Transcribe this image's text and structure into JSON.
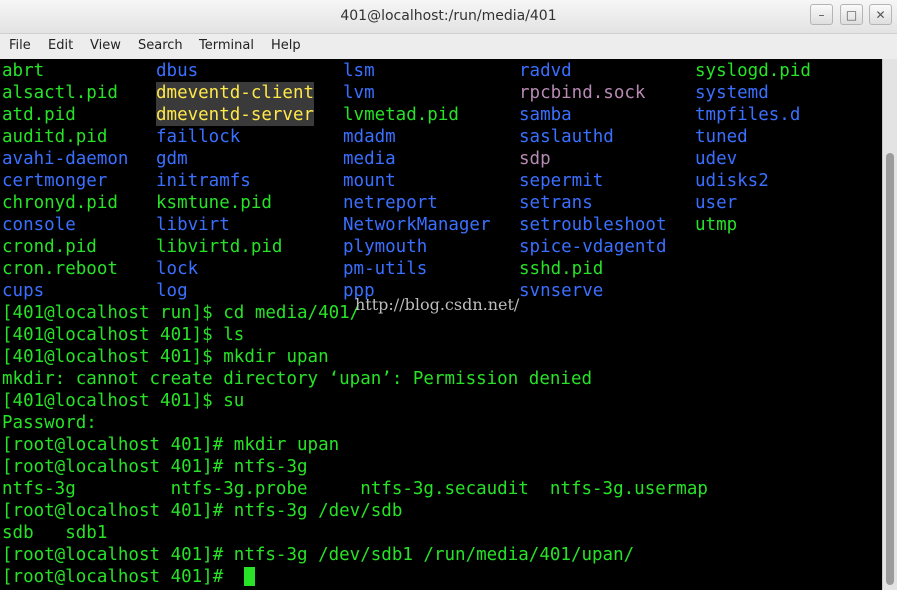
{
  "window": {
    "title": "401@localhost:/run/media/401",
    "minimize_glyph": "–",
    "maximize_glyph": "□",
    "close_glyph": "✕"
  },
  "menu": {
    "file": "File",
    "edit": "Edit",
    "view": "View",
    "search": "Search",
    "terminal": "Terminal",
    "help": "Help"
  },
  "listing": {
    "col1": [
      "abrt",
      "alsactl.pid",
      "atd.pid",
      "auditd.pid",
      "avahi-daemon",
      "certmonger",
      "chronyd.pid",
      "console",
      "crond.pid",
      "cron.reboot",
      "cups"
    ],
    "col2": [
      "dbus",
      "dmeventd-client",
      "dmeventd-server",
      "faillock",
      "gdm",
      "initramfs",
      "ksmtune.pid",
      "libvirt",
      "libvirtd.pid",
      "lock",
      "log"
    ],
    "col3": [
      "lsm",
      "lvm",
      "lvmetad.pid",
      "mdadm",
      "media",
      "mount",
      "netreport",
      "NetworkManager",
      "plymouth",
      "pm-utils",
      "ppp"
    ],
    "col4": [
      "radvd",
      "rpcbind.sock",
      "samba",
      "saslauthd",
      "sdp",
      "sepermit",
      "setrans",
      "setroubleshoot",
      "spice-vdagentd",
      "sshd.pid",
      "svnserve"
    ],
    "col5": [
      "syslogd.pid",
      "systemd",
      "tmpfiles.d",
      "tuned",
      "udev",
      "udisks2",
      "user",
      "utmp"
    ]
  },
  "colors": {
    "col1": [
      "green",
      "green",
      "green",
      "green",
      "blue",
      "blue",
      "green",
      "blue",
      "green",
      "green",
      "blue"
    ],
    "col2": [
      "blue",
      "yellow",
      "yellow",
      "blue",
      "blue",
      "blue",
      "green",
      "blue",
      "green",
      "blue",
      "blue"
    ],
    "col3": [
      "blue",
      "blue",
      "green",
      "blue",
      "blue",
      "blue",
      "blue",
      "blue",
      "blue",
      "blue",
      "blue"
    ],
    "col4": [
      "blue",
      "pink",
      "blue",
      "blue",
      "pink",
      "blue",
      "blue",
      "blue",
      "blue",
      "green",
      "blue"
    ],
    "col5": [
      "green",
      "blue",
      "blue",
      "blue",
      "blue",
      "blue",
      "blue",
      "green"
    ]
  },
  "output": [
    "[401@localhost run]$ cd media/401/",
    "[401@localhost 401]$ ls",
    "[401@localhost 401]$ mkdir upan",
    "mkdir: cannot create directory ‘upan’: Permission denied",
    "[401@localhost 401]$ su",
    "Password:",
    "[root@localhost 401]# mkdir upan",
    "[root@localhost 401]# ntfs-3g",
    "ntfs-3g         ntfs-3g.probe     ntfs-3g.secaudit  ntfs-3g.usermap",
    "[root@localhost 401]# ntfs-3g /dev/sdb",
    "sdb   sdb1",
    "[root@localhost 401]# ntfs-3g /dev/sdb1 /run/media/401/upan/",
    "[root@localhost 401]# "
  ],
  "watermark": "http://blog.csdn.net/"
}
